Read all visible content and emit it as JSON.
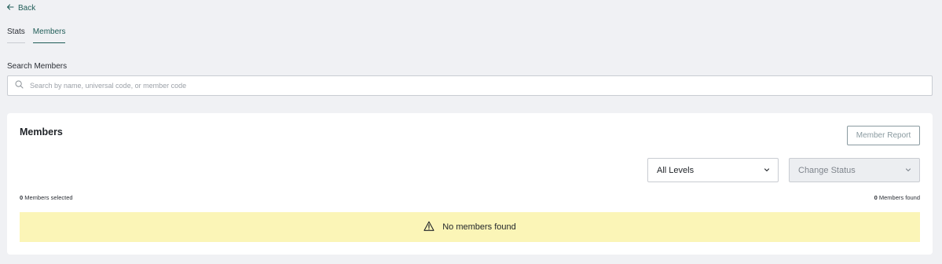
{
  "nav": {
    "back_label": "Back"
  },
  "tabs": [
    {
      "label": "Stats",
      "active": false
    },
    {
      "label": "Members",
      "active": true
    }
  ],
  "search": {
    "label": "Search Members",
    "placeholder": "Search by name, universal code, or member code",
    "value": ""
  },
  "members_card": {
    "title": "Members",
    "report_button": "Member Report",
    "level_filter": {
      "selected": "All Levels"
    },
    "status_select": {
      "selected": "Change Status"
    },
    "selected_count": "0",
    "selected_text": "Members selected",
    "found_count": "0",
    "found_text": "Members found",
    "empty_message": "No members found"
  },
  "colors": {
    "accent": "#1f5c57",
    "page_background": "#f0f1f4",
    "empty_banner": "#fbf5b7"
  },
  "icons": {
    "back": "arrow-left-icon",
    "search": "search-icon",
    "dropdown": "chevron-down-icon",
    "warning": "warning-triangle-icon"
  }
}
